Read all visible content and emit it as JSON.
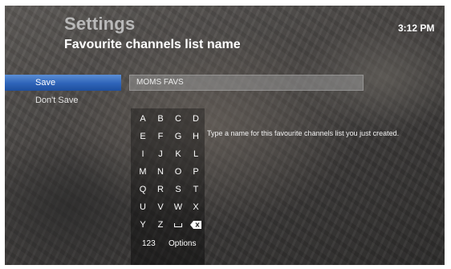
{
  "header": {
    "title": "Settings",
    "subtitle": "Favourite channels list name",
    "clock": "3:12 PM"
  },
  "menu": {
    "items": [
      {
        "label": "Save",
        "selected": true
      },
      {
        "label": "Don't Save",
        "selected": false
      }
    ]
  },
  "name_field": {
    "value": "MOMS FAVS"
  },
  "keypad": {
    "rows": [
      [
        "A",
        "B",
        "C",
        "D"
      ],
      [
        "E",
        "F",
        "G",
        "H"
      ],
      [
        "I",
        "J",
        "K",
        "L"
      ],
      [
        "M",
        "N",
        "O",
        "P"
      ],
      [
        "Q",
        "R",
        "S",
        "T"
      ],
      [
        "U",
        "V",
        "W",
        "X"
      ],
      [
        "Y",
        "Z",
        "space-icon",
        "backspace-icon"
      ]
    ],
    "numbers_label": "123",
    "options_label": "Options"
  },
  "help_text": "Type a name for this favourite channels list you just created.",
  "colors": {
    "selection": "#2e63b8",
    "title": "#b9b9b9",
    "text": "#ffffff"
  }
}
